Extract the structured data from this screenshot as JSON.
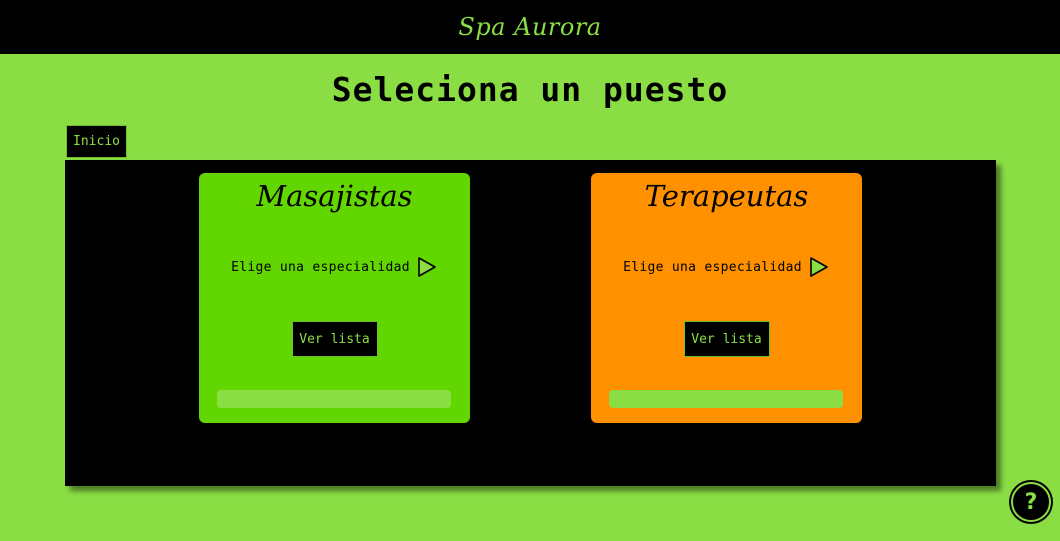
{
  "header": {
    "brand": "Spa Aurora"
  },
  "page": {
    "title": "Seleciona un puesto"
  },
  "nav": {
    "home_label": "Inicio"
  },
  "cards": [
    {
      "title": "Masajistas",
      "specialty_label": "Elige una especialidad",
      "button_label": "Ver lista",
      "background": "#62d600"
    },
    {
      "title": "Terapeutas",
      "specialty_label": "Elige una especialidad",
      "button_label": "Ver lista",
      "background": "#ff9100"
    }
  ],
  "help": {
    "label": "?"
  },
  "colors": {
    "accent": "#8ade44",
    "panel": "#000000"
  }
}
